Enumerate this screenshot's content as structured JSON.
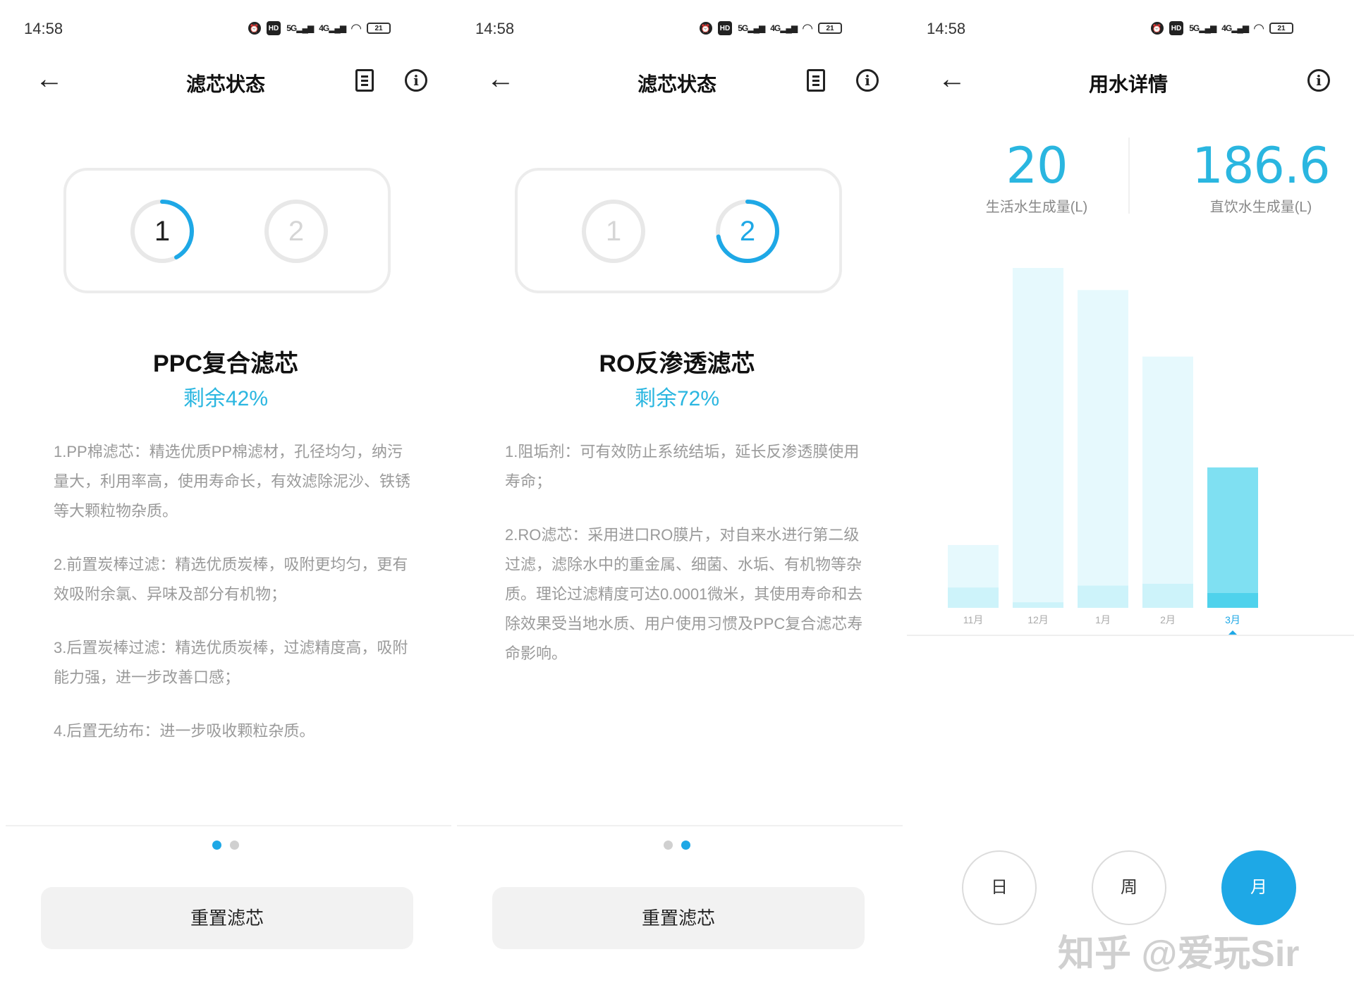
{
  "status_bar": {
    "time": "14:58",
    "icons": [
      "alarm-icon",
      "hd-icon",
      "signal-5g-icon",
      "signal-4g-icon",
      "wifi-icon",
      "battery-icon"
    ],
    "battery": "21"
  },
  "panel1": {
    "title": "滤芯状态",
    "filter_name": "PPC复合滤芯",
    "remaining": "剩余42%",
    "remaining_fraction": 0.42,
    "filters": [
      {
        "num": "1",
        "active": true
      },
      {
        "num": "2",
        "active": false
      }
    ],
    "description": [
      "1.PP棉滤芯：精选优质PP棉滤材，孔径均匀，纳污量大，利用率高，使用寿命长，有效滤除泥沙、铁锈等大颗粒物杂质。",
      "2.前置炭棒过滤：精选优质炭棒，吸附更均匀，更有效吸附余氯、异味及部分有机物；",
      "3.后置炭棒过滤：精选优质炭棒，过滤精度高，吸附能力强，进一步改善口感；",
      "4.后置无纺布：进一步吸收颗粒杂质。"
    ],
    "reset_label": "重置滤芯",
    "page_index": 0
  },
  "panel2": {
    "title": "滤芯状态",
    "filter_name": "RO反渗透滤芯",
    "remaining": "剩余72%",
    "remaining_fraction": 0.72,
    "filters": [
      {
        "num": "1",
        "active": false
      },
      {
        "num": "2",
        "active": true
      }
    ],
    "description": [
      "1.阻垢剂：可有效防止系统结垢，延长反渗透膜使用寿命；",
      "2.RO滤芯：采用进口RO膜片，对自来水进行第二级过滤，滤除水中的重金属、细菌、水垢、有机物等杂质。理论过滤精度可达0.0001微米，其使用寿命和去除效果受当地水质、用户使用习惯及PPC复合滤芯寿命影响。"
    ],
    "reset_label": "重置滤芯",
    "page_index": 1
  },
  "panel3": {
    "title": "用水详情",
    "stats": [
      {
        "value": "20",
        "label": "生活水生成量(L)"
      },
      {
        "value": "186.6",
        "label": "直饮水生成量(L)"
      }
    ],
    "periods": [
      {
        "label": "日",
        "active": false
      },
      {
        "label": "周",
        "active": false
      },
      {
        "label": "月",
        "active": true
      }
    ]
  },
  "chart_data": {
    "type": "bar",
    "categories": [
      "11月",
      "12月",
      "1月",
      "2月",
      "3月"
    ],
    "series": [
      {
        "values": [
          17,
          100,
          86,
          68,
          38
        ]
      },
      {
        "values": [
          5.5,
          1.5,
          6,
          6.5,
          4
        ]
      }
    ],
    "selected_category": "3月",
    "ylim": [
      0,
      100
    ],
    "colors": {
      "bar_light": "#e6f9fd",
      "bar_lower": "#cdf3fa",
      "bar_selected": "#7fe0f2",
      "bar_selected_lower": "#4fd2ec",
      "accent": "#1ea8e6"
    }
  },
  "watermark": "知乎 @爱玩Sir"
}
